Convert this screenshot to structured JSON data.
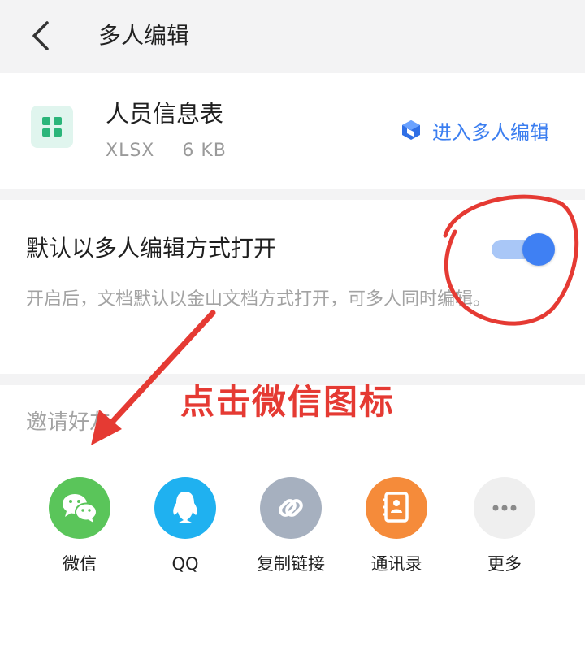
{
  "header": {
    "title": "多人编辑",
    "back_icon": "chevron-left-icon"
  },
  "file": {
    "name": "人员信息表",
    "format": "XLSX",
    "size": "6 KB",
    "icon": "spreadsheet-icon",
    "enter_label": "进入多人编辑",
    "enter_icon": "cube-icon",
    "accent": "#3b7ef0"
  },
  "default_open": {
    "title": "默认以多人编辑方式打开",
    "description": "开启后，文档默认以金山文档方式打开，可多人同时编辑。",
    "enabled": true
  },
  "invite": {
    "label": "邀请好友"
  },
  "share_options": [
    {
      "label": "微信",
      "icon": "wechat-icon",
      "color": "#5ac55a"
    },
    {
      "label": "QQ",
      "icon": "qq-penguin-icon",
      "color": "#1fb1f0"
    },
    {
      "label": "复制链接",
      "icon": "link-icon",
      "color": "#a6b0bf"
    },
    {
      "label": "通讯录",
      "icon": "contacts-icon",
      "color": "#f58b3a"
    },
    {
      "label": "更多",
      "icon": "more-dots-icon",
      "color": "#efefef"
    }
  ],
  "annotation": {
    "text": "点击微信图标",
    "color": "#e53a33"
  }
}
